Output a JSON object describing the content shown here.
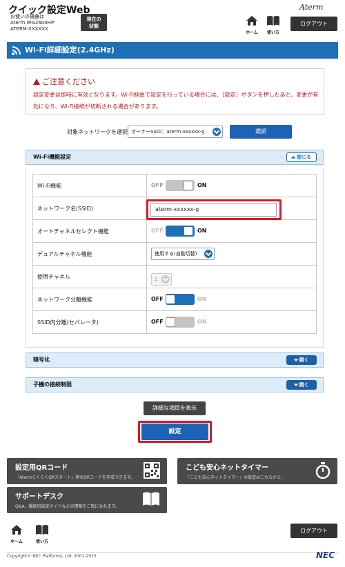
{
  "header": {
    "app_title": "クイック設定Web",
    "device_lines": [
      "お使いの機器は",
      "Aterm WG2600HP",
      "ATERM-XXXXXX"
    ],
    "current_status_line1": "現在の",
    "current_status_line2": "状態",
    "brand": "Aterm",
    "home_label": "ホーム",
    "help_label": "使い方",
    "logout_label": "ログアウト"
  },
  "page": {
    "title": "Wi-Fi詳細設定(2.4GHz)"
  },
  "caution": {
    "title": "ご注意ください",
    "text": "設定変更は即時に有効となります。Wi-Fi経由で設定を行っている場合には、［設定］ボタンを押したあと、変更が有効になり、Wi-Fi接続が切断される場合があります。"
  },
  "network_select": {
    "label": "対象ネットワークを選択",
    "value": "オーナーSSID：aterm-xxxxxx-g",
    "button": "選択"
  },
  "wifi_section": {
    "title": "Wi-Fi機能設定",
    "toggle": "閉じる",
    "rows": [
      {
        "label": "Wi-Fi機能",
        "off": "OFF",
        "on": "ON"
      },
      {
        "label": "ネットワーク名(SSID)",
        "value": "aterm-xxxxxx-g"
      },
      {
        "label": "オートチャネルセレクト機能",
        "off": "OFF",
        "on": "ON"
      },
      {
        "label": "デュアルチャネル機能",
        "value": "使用する(自動切替)"
      },
      {
        "label": "使用チャネル",
        "value": "1"
      },
      {
        "label": "ネットワーク分離機能",
        "off": "OFF",
        "on": "ON"
      },
      {
        "label": "SSID内分離(セパレータ)",
        "off": "OFF",
        "on": "ON"
      }
    ]
  },
  "encryption_section": {
    "title": "暗号化",
    "toggle": "開く"
  },
  "client_section": {
    "title": "子機の接続制限",
    "toggle": "開く"
  },
  "buttons": {
    "show_details": "詳細な項目を表示",
    "apply": "設定"
  },
  "tiles": {
    "qr": {
      "title": "設定用QRコード",
      "sub": "「AtermらくらくQRスタート」用のQRコードを作成できます。"
    },
    "timer": {
      "title": "こども安心ネットタイマー",
      "sub": "「こども安心ネットタイマー」の設定はこちらから。"
    },
    "support": {
      "title": "サポートデスク",
      "sub": "Q&A、機能別設定ガイドなどの情報をご覧になれます。"
    }
  },
  "footer": {
    "home_label": "ホーム",
    "help_label": "使い方",
    "logout_label": "ログアウト",
    "copyright": "Copyright© NEC Platforms, Ltd. 2001-2015",
    "nec": "NEC"
  },
  "colors": {
    "accent_blue": "#1e6fb5",
    "alert_red": "#c0141c",
    "highlight_red": "#e0161e",
    "dark_button": "#333333"
  }
}
